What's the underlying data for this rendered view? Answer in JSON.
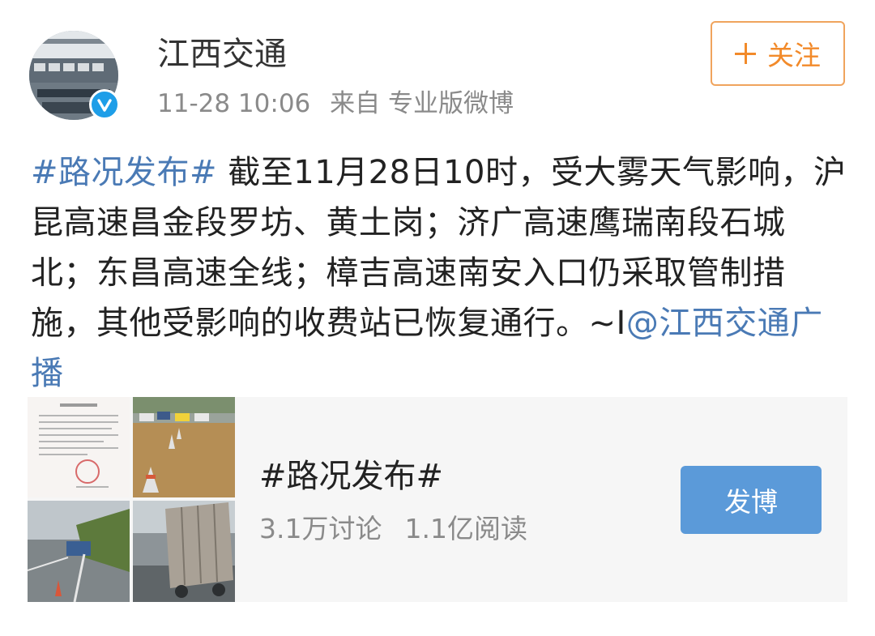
{
  "header": {
    "username": "江西交通",
    "time": "11-28 10:06",
    "source": "来自 专业版微博",
    "follow_label": "关注"
  },
  "post": {
    "hashtag": "#路况发布#",
    "body": " 截至11月28日10时，受大雾天气影响，沪昆高速昌金段罗坊、黄土岗；济广高速鹰瑞南段石城北；东昌高速全线；樟吉高速南安入口仍采取管制措施，其他受影响的收费站已恢复通行。~I",
    "mention": "@江西交通广播"
  },
  "topic_card": {
    "title": "#路况发布#",
    "discussions": "3.1万讨论",
    "reads": "1.1亿阅读",
    "post_label": "发博"
  },
  "colors": {
    "link": "#4a7ab5",
    "follow_accent": "#f28a2a",
    "post_button": "#5b9ad9",
    "verified_badge": "#1e9ee8"
  }
}
